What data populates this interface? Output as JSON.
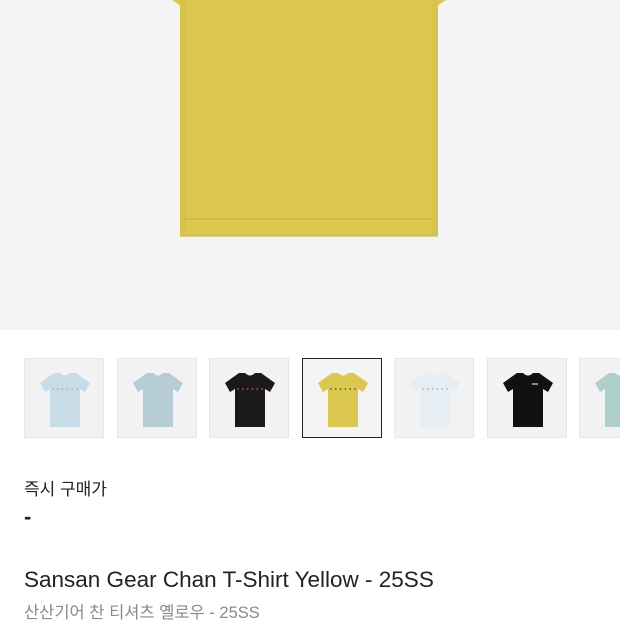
{
  "product": {
    "hero_image": "yellow-t-shirt-photo",
    "hero_shirt_color": "#DCC84E",
    "hero_background": "#F4F4F4",
    "instant_price_label": "즉시 구매가",
    "instant_price_value": "-",
    "title_en": "Sansan Gear Chan T-Shirt Yellow - 25SS",
    "title_ko": "산산기어 찬 티셔츠 옐로우 - 25SS"
  },
  "thumbnails": [
    {
      "color": "#C7DCE6",
      "label": "light-blue-t-shirt",
      "selected": false,
      "graphic": "light"
    },
    {
      "color": "#B7CDD6",
      "label": "pale-blue-t-shirt",
      "selected": false,
      "graphic": "none"
    },
    {
      "color": "#1A1A1A",
      "label": "black-t-shirt",
      "selected": false,
      "graphic": "red-dots"
    },
    {
      "color": "#DCC84E",
      "label": "yellow-t-shirt",
      "selected": true,
      "graphic": "dark-dots"
    },
    {
      "color": "#E7EEF3",
      "label": "white-t-shirt",
      "selected": false,
      "graphic": "light"
    },
    {
      "color": "#111111",
      "label": "black-logo-t-shirt",
      "selected": false,
      "graphic": "logo"
    },
    {
      "color": "#AFCFCC",
      "label": "mint-t-shirt",
      "selected": false,
      "graphic": "none"
    }
  ]
}
